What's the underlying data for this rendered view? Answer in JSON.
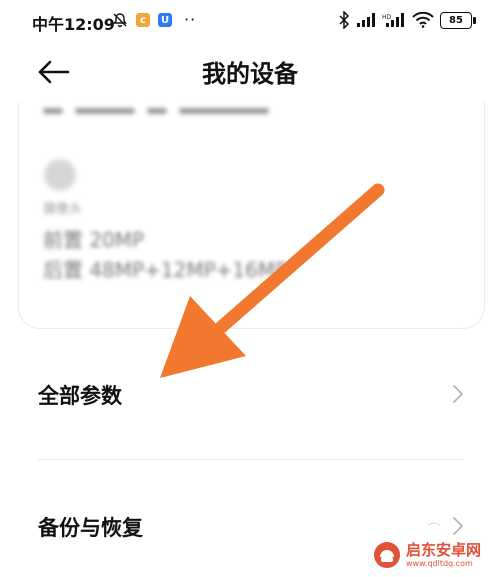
{
  "status_bar": {
    "time": "中午12:09",
    "icons": [
      "bell-off-icon",
      "app-badge-orange-icon",
      "app-badge-blue-icon"
    ],
    "more": "··",
    "right_icons": [
      "bluetooth-icon",
      "signal-icon",
      "signal-hd-icon",
      "wifi-icon"
    ],
    "battery": "85"
  },
  "header": {
    "title": "我的设备",
    "back_icon": "arrow-left-icon"
  },
  "device_card": {
    "camera_label": "摄像头",
    "front_camera": "前置 20MP",
    "rear_camera": "后置 48MP+12MP+16MP"
  },
  "menu": {
    "items": [
      {
        "label": "全部参数",
        "icon": "chevron-right-icon"
      },
      {
        "label": "备份与恢复",
        "icon": "chevron-right-icon"
      }
    ]
  },
  "colors": {
    "accent_arrow": "#f2782f",
    "badge_orange": "#f2a53a",
    "badge_blue": "#2f7cf6",
    "watermark": "#e2513a"
  },
  "watermark": {
    "name": "启东安卓网",
    "url": "www.qdltdq.com"
  }
}
